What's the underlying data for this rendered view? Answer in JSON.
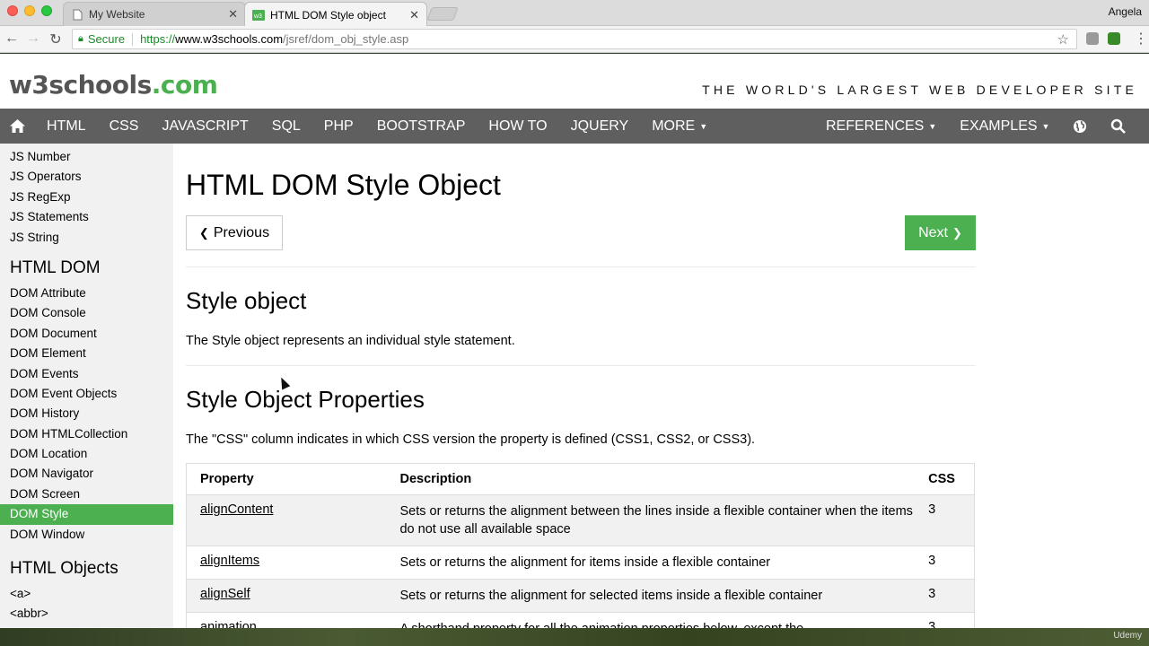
{
  "browser": {
    "tabs": [
      {
        "title": "My Website",
        "active": false
      },
      {
        "title": "HTML DOM Style object",
        "active": true
      }
    ],
    "profile_name": "Angela",
    "secure_label": "Secure",
    "url_scheme": "https://",
    "url_host": "www.w3schools.com",
    "url_path": "/jsref/dom_obj_style.asp"
  },
  "header": {
    "logo_main": "w3schools",
    "logo_tld": ".com",
    "tagline": "THE WORLD'S LARGEST WEB DEVELOPER SITE"
  },
  "topnav": {
    "items": [
      "HTML",
      "CSS",
      "JAVASCRIPT",
      "SQL",
      "PHP",
      "BOOTSTRAP",
      "HOW TO",
      "JQUERY",
      "MORE"
    ],
    "right_items": [
      "REFERENCES",
      "EXAMPLES"
    ]
  },
  "sidebar": {
    "js_links": [
      "JS Number",
      "JS Operators",
      "JS RegExp",
      "JS Statements",
      "JS String"
    ],
    "heading_dom": "HTML DOM",
    "dom_links": [
      "DOM Attribute",
      "DOM Console",
      "DOM Document",
      "DOM Element",
      "DOM Events",
      "DOM Event Objects",
      "DOM History",
      "DOM HTMLCollection",
      "DOM Location",
      "DOM Navigator",
      "DOM Screen",
      "DOM Style",
      "DOM Window"
    ],
    "active_link": "DOM Style",
    "heading_objects": "HTML Objects",
    "object_links": [
      "<a>",
      "<abbr>"
    ]
  },
  "main": {
    "title": "HTML DOM Style Object",
    "prev_label": "Previous",
    "next_label": "Next",
    "section1_title": "Style object",
    "section1_text": "The Style object represents an individual style statement.",
    "section2_title": "Style Object Properties",
    "section2_text": "The \"CSS\" column indicates in which CSS version the property is defined (CSS1, CSS2, or CSS3).",
    "table": {
      "headers": [
        "Property",
        "Description",
        "CSS"
      ],
      "rows": [
        {
          "property": "alignContent",
          "description": "Sets or returns the alignment between the lines inside a flexible container when the items do not use all available space",
          "css": "3"
        },
        {
          "property": "alignItems",
          "description": "Sets or returns the alignment for items inside a flexible container",
          "css": "3"
        },
        {
          "property": "alignSelf",
          "description": "Sets or returns the alignment for selected items inside a flexible container",
          "css": "3"
        },
        {
          "property": "animation",
          "description": "A shorthand property for all the animation properties below, except the",
          "css": "3"
        }
      ]
    }
  },
  "watermark": "Udemy"
}
